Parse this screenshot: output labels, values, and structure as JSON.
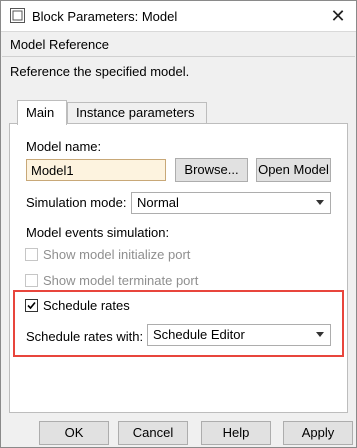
{
  "window": {
    "title": "Block Parameters: Model"
  },
  "header": {
    "section_title": "Model Reference",
    "description": "Reference the specified model."
  },
  "tabs": [
    {
      "label": "Main",
      "active": true
    },
    {
      "label": "Instance parameters",
      "active": false
    }
  ],
  "main": {
    "model_name_label": "Model name:",
    "model_name_value": "Model1",
    "browse_label": "Browse...",
    "open_model_label": "Open Model",
    "simulation_mode_label": "Simulation mode:",
    "simulation_mode_value": "Normal",
    "model_events_label": "Model events simulation:",
    "show_init_port_label": "Show model initialize port",
    "show_term_port_label": "Show model terminate port",
    "schedule_rates_label": "Schedule rates",
    "schedule_rates_checked": true,
    "schedule_rates_with_label": "Schedule rates with:",
    "schedule_rates_with_value": "Schedule Editor"
  },
  "footer": {
    "ok_label": "OK",
    "cancel_label": "Cancel",
    "help_label": "Help",
    "apply_label": "Apply"
  },
  "colors": {
    "highlight": "#e8453c",
    "input_bg": "#fdf3df"
  },
  "icons": {
    "app": "simulink-block-icon",
    "close": "close-icon",
    "dropdown": "chevron-down-icon",
    "check": "checkmark-icon"
  }
}
